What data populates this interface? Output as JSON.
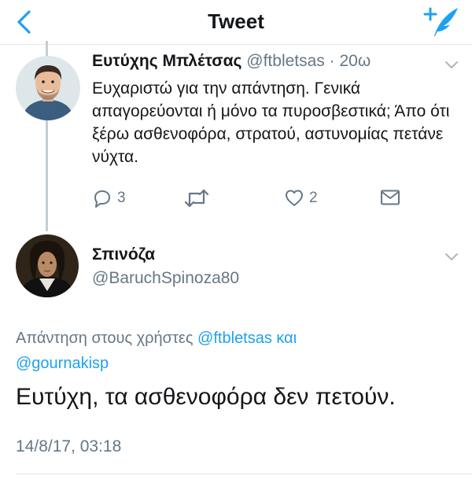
{
  "header": {
    "title": "Tweet"
  },
  "tweet1": {
    "name": "Ευτύχης Μπλέτσας",
    "handle": "@ftbletsas",
    "separator": "·",
    "age": "20ω",
    "text": "Ευχαριστώ για την απάντηση. Γενικά απαγορεύονται ή μόνο τα πυροσβεστικά; Άπο ότι ξέρω ασθενοφόρα, στρατού, αστυνομίας πετάνε νύχτα.",
    "replies": "3",
    "likes": "2"
  },
  "tweet2": {
    "name": "Σπινόζα",
    "handle": "@BaruchSpinoza80",
    "reply_prefix": "Απάντηση στους χρήστες",
    "reply_user1": "@ftbletsas",
    "reply_conj": "και",
    "reply_user2": "@gournakisp",
    "text": "Ευτύχη, τα ασθενοφόρα δεν πετούν.",
    "timestamp": "14/8/17, 03:18"
  },
  "icons": {
    "back": "chevron-left-icon",
    "compose": "compose-tweet-icon",
    "reply": "reply-icon",
    "retweet": "retweet-icon",
    "like": "heart-icon",
    "dm": "envelope-icon",
    "menu": "chevron-down-icon"
  },
  "colors": {
    "accent": "#1da1f2",
    "muted": "#657786",
    "text": "#14171a"
  }
}
